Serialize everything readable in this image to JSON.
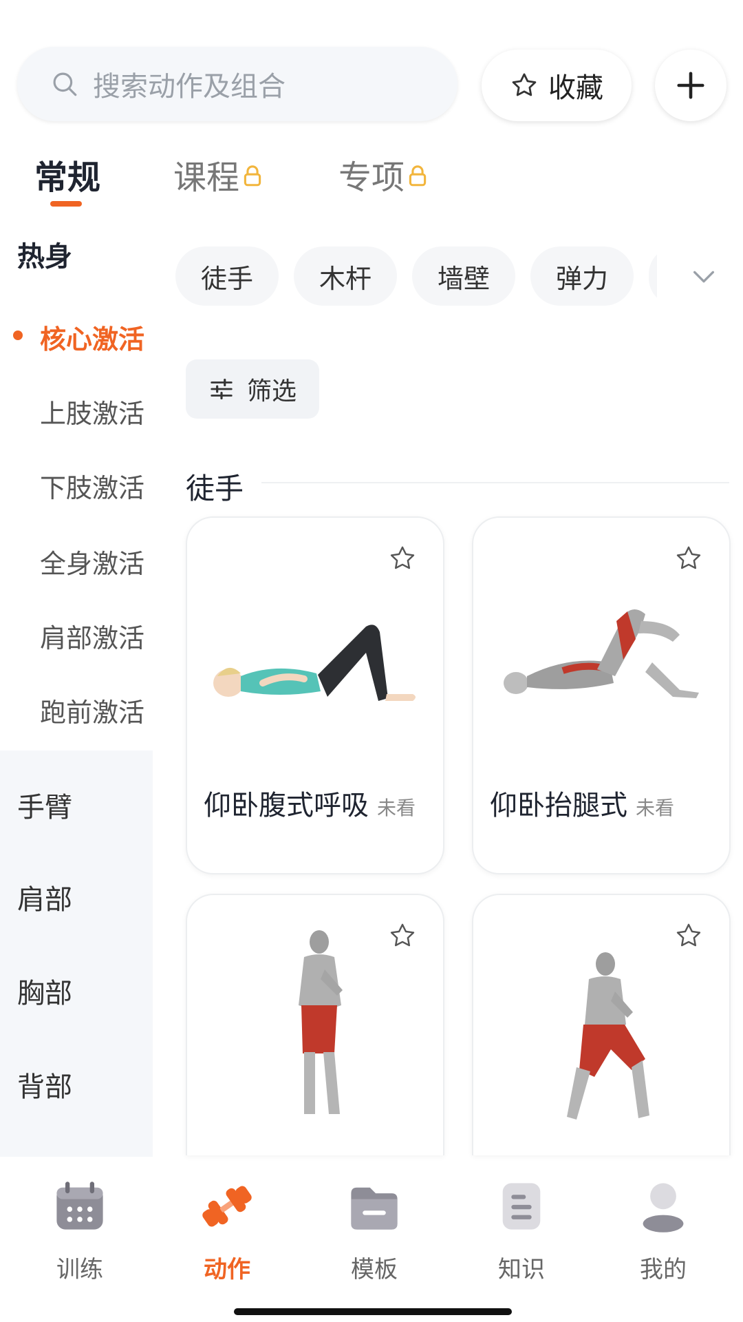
{
  "search": {
    "placeholder": "搜索动作及组合",
    "icon": "search-icon"
  },
  "header": {
    "favorite_label": "收藏",
    "add_icon": "plus-icon"
  },
  "tabs": [
    {
      "label": "常规",
      "active": true,
      "locked": false
    },
    {
      "label": "课程",
      "active": false,
      "locked": true
    },
    {
      "label": "专项",
      "active": false,
      "locked": true
    }
  ],
  "sidebar": {
    "group_title": "热身",
    "sub_items": [
      {
        "label": "核心激活",
        "active": true
      },
      {
        "label": "上肢激活",
        "active": false
      },
      {
        "label": "下肢激活",
        "active": false
      },
      {
        "label": "全身激活",
        "active": false
      },
      {
        "label": "肩部激活",
        "active": false
      },
      {
        "label": "跑前激活",
        "active": false
      }
    ],
    "categories": [
      {
        "label": "手臂"
      },
      {
        "label": "肩部"
      },
      {
        "label": "胸部"
      },
      {
        "label": "背部"
      }
    ]
  },
  "chips": [
    {
      "label": "徒手"
    },
    {
      "label": "木杆"
    },
    {
      "label": "墙壁"
    },
    {
      "label": "弹力"
    }
  ],
  "filter": {
    "label": "筛选"
  },
  "section": {
    "title": "徒手"
  },
  "cards": [
    {
      "name": "仰卧腹式呼吸",
      "badge": "未看",
      "image": "supine-breathing-illustration"
    },
    {
      "name": "仰卧抬腿式",
      "badge": "未看",
      "image": "supine-leg-raise-illustration"
    },
    {
      "name": "",
      "badge": "",
      "image": "standing-squat-illustration"
    },
    {
      "name": "",
      "badge": "",
      "image": "lunge-illustration"
    }
  ],
  "bottom_nav": [
    {
      "label": "训练",
      "icon": "calendar-icon",
      "active": false
    },
    {
      "label": "动作",
      "icon": "dumbbell-icon",
      "active": true
    },
    {
      "label": "模板",
      "icon": "folder-icon",
      "active": false
    },
    {
      "label": "知识",
      "icon": "document-icon",
      "active": false
    },
    {
      "label": "我的",
      "icon": "profile-icon",
      "active": false
    }
  ],
  "colors": {
    "accent": "#f06423",
    "sidebar_bg": "#f5f7fa",
    "lock": "#f2b53c"
  }
}
